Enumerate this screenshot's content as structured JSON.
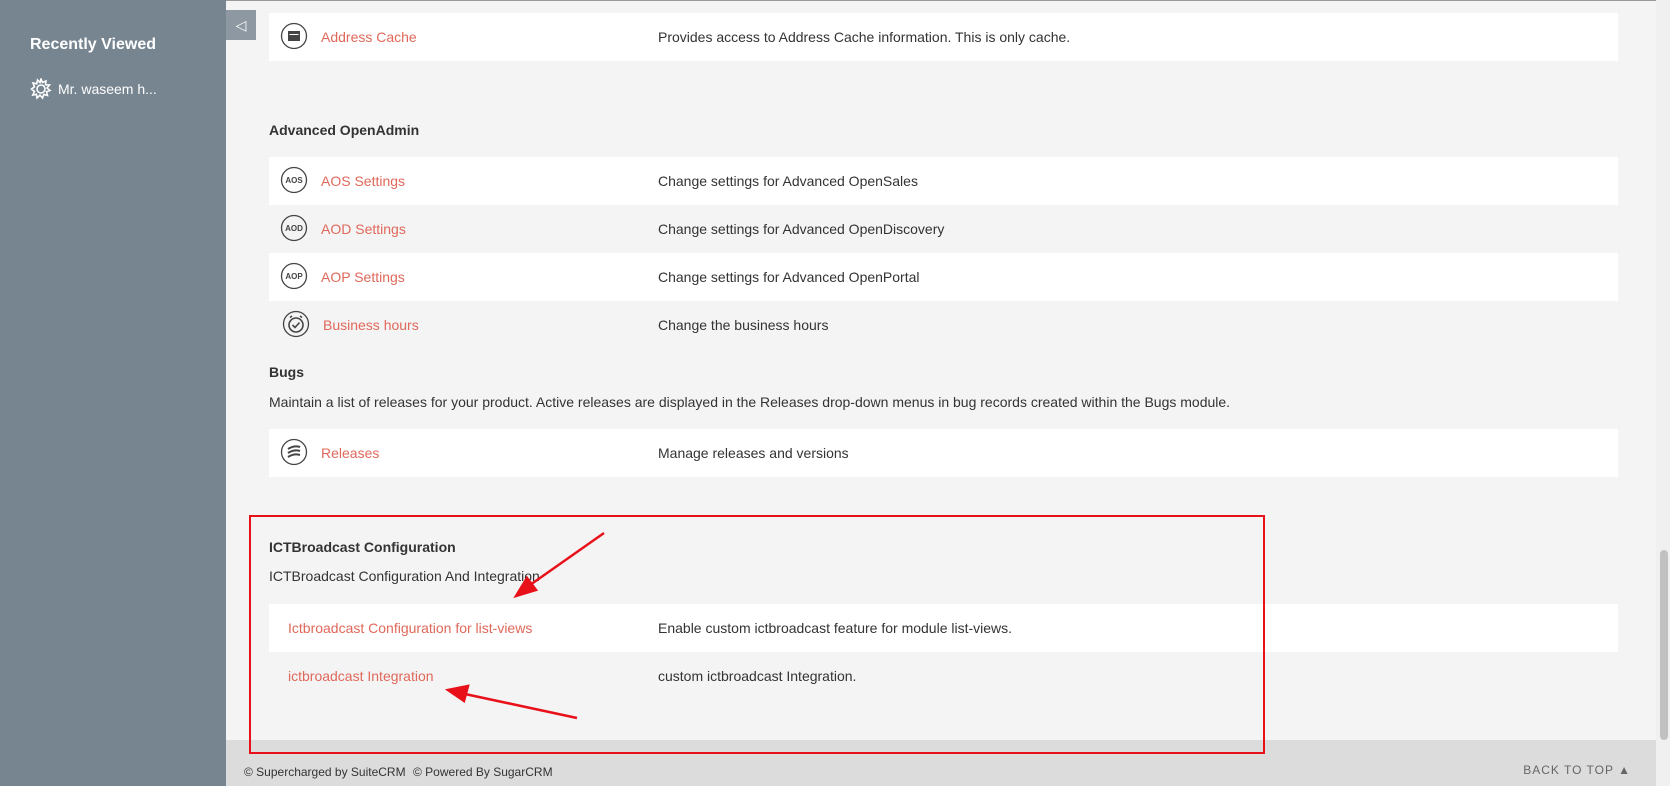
{
  "sidebar": {
    "title": "Recently Viewed",
    "items": [
      {
        "label": "Mr. waseem h...",
        "icon": "gear-icon"
      }
    ],
    "collapse_icon": "collapse-left-icon"
  },
  "sections": {
    "address_cache": {
      "link": "Address Cache",
      "desc": "Provides access to Address Cache information. This is only cache.",
      "icon": "calendar-icon"
    },
    "advanced_openadmin": {
      "title": "Advanced OpenAdmin",
      "rows": [
        {
          "link": "AOS Settings",
          "desc": "Change settings for Advanced OpenSales",
          "icon_text": "AOS"
        },
        {
          "link": "AOD Settings",
          "desc": "Change settings for Advanced OpenDiscovery",
          "icon_text": "AOD"
        },
        {
          "link": "AOP Settings",
          "desc": "Change settings for Advanced OpenPortal",
          "icon_text": "AOP"
        },
        {
          "link": "Business hours",
          "desc": "Change the business hours",
          "icon": "clock-icon"
        }
      ]
    },
    "bugs": {
      "title": "Bugs",
      "description": "Maintain a list of releases for your product. Active releases are displayed in the Releases drop-down menus in bug records created within the Bugs module.",
      "rows": [
        {
          "link": "Releases",
          "desc": "Manage releases and versions",
          "icon": "releases-icon"
        }
      ]
    },
    "ictbroadcast": {
      "title": "ICTBroadcast Configuration",
      "description": "ICTBroadcast Configuration And Integration",
      "rows": [
        {
          "link": "Ictbroadcast Configuration for list-views",
          "desc": "Enable custom ictbroadcast feature for module list-views."
        },
        {
          "link": "ictbroadcast Integration",
          "desc": "custom ictbroadcast Integration."
        }
      ]
    }
  },
  "footer": {
    "supercharged": "© Supercharged by SuiteCRM",
    "powered": "© Powered By SugarCRM",
    "back_to_top": "BACK TO TOP  ▲"
  },
  "colors": {
    "sidebar_bg": "#778591",
    "link": "#e0685a",
    "highlight_box": "#e8111a",
    "footer_bg": "#dcdcdc"
  }
}
